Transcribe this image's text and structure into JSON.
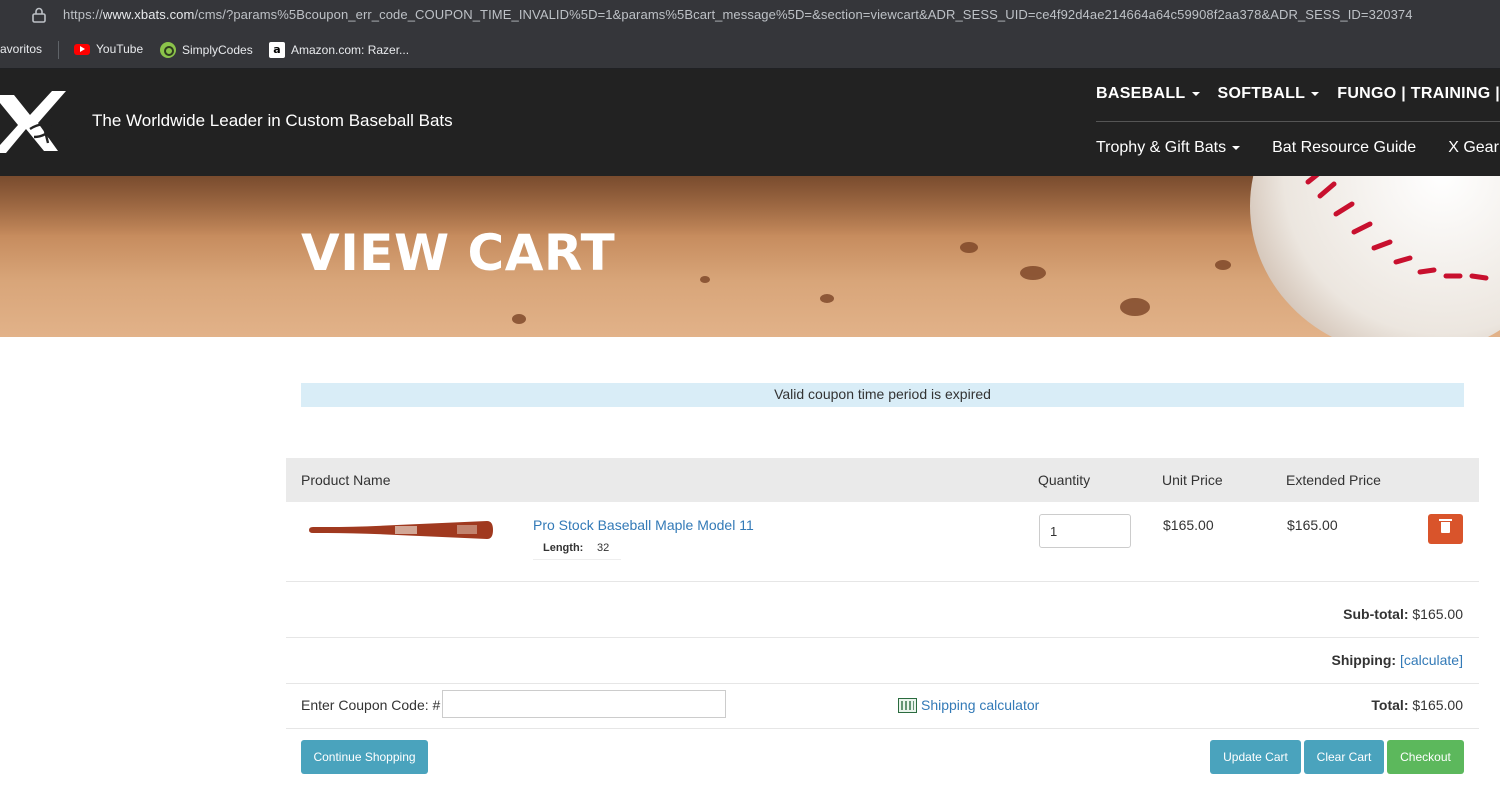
{
  "browser": {
    "url_prefix": "https://",
    "url_domain": "www.xbats.com",
    "url_rest": "/cms/?params%5Bcoupon_err_code_COUPON_TIME_INVALID%5D=1&params%5Bcart_message%5D=&section=viewcart&ADR_SESS_UID=ce4f92d4ae214664a64c59908f2aa378&ADR_SESS_ID=320374",
    "bookmarks": {
      "favorites": "avoritos",
      "youtube": "YouTube",
      "simplycodes": "SimplyCodes",
      "amazon": "Amazon.com: Razer..."
    }
  },
  "header": {
    "tagline": "The Worldwide Leader in Custom Baseball Bats",
    "nav_primary": [
      "BASEBALL",
      "SOFTBALL",
      "FUNGO | TRAINING | COACH"
    ],
    "nav_secondary": [
      "Trophy & Gift Bats",
      "Bat Resource Guide",
      "X Gear"
    ]
  },
  "hero": {
    "title": "VIEW CART"
  },
  "alert": {
    "message": "Valid coupon time period is expired"
  },
  "cart": {
    "columns": {
      "product": "Product Name",
      "quantity": "Quantity",
      "unit_price": "Unit Price",
      "extended_price": "Extended Price"
    },
    "items": [
      {
        "name": "Pro Stock Baseball Maple Model 11",
        "option_label": "Length:",
        "option_value": "32",
        "quantity": "1",
        "unit_price": "$165.00",
        "extended_price": "$165.00"
      }
    ],
    "subtotal_label": "Sub-total:",
    "subtotal_value": "$165.00",
    "shipping_label": "Shipping:",
    "shipping_link": "[calculate]",
    "total_label": "Total:",
    "total_value": "$165.00",
    "coupon_label": "Enter Coupon Code: #",
    "coupon_value": "",
    "shipping_calc_link": "Shipping calculator"
  },
  "buttons": {
    "continue": "Continue Shopping",
    "update": "Update Cart",
    "clear": "Clear Cart",
    "checkout": "Checkout"
  }
}
